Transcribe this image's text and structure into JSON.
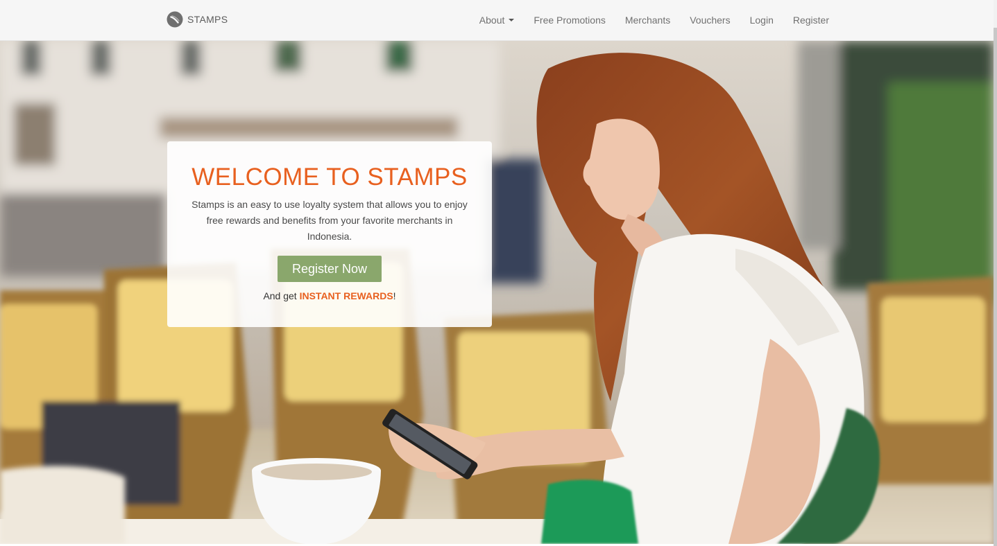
{
  "nav": {
    "brand": {
      "icon": "stamps-logo-icon",
      "label": "STAMPS"
    },
    "items": [
      {
        "label": "About",
        "has_dropdown": true
      },
      {
        "label": "Free Promotions"
      },
      {
        "label": "Merchants"
      },
      {
        "label": "Vouchers"
      },
      {
        "label": "Login"
      },
      {
        "label": "Register"
      }
    ]
  },
  "hero": {
    "background": "Woman with long auburn hair in a white sleeveless blouse looking at her phone at an outdoor café with rattan chairs and a coffee cup",
    "card": {
      "title": "WELCOME TO STAMPS",
      "description": "Stamps is an easy to use loyalty system that allows you to enjoy free rewards and benefits from your favorite merchants in Indonesia.",
      "cta_label": "Register Now",
      "reward_prefix": "And get ",
      "reward_highlight": "INSTANT REWARDS",
      "reward_suffix": "!"
    }
  },
  "colors": {
    "accent": "#e8601f",
    "cta": "#8aa76c",
    "navbar": "#f6f6f6"
  }
}
